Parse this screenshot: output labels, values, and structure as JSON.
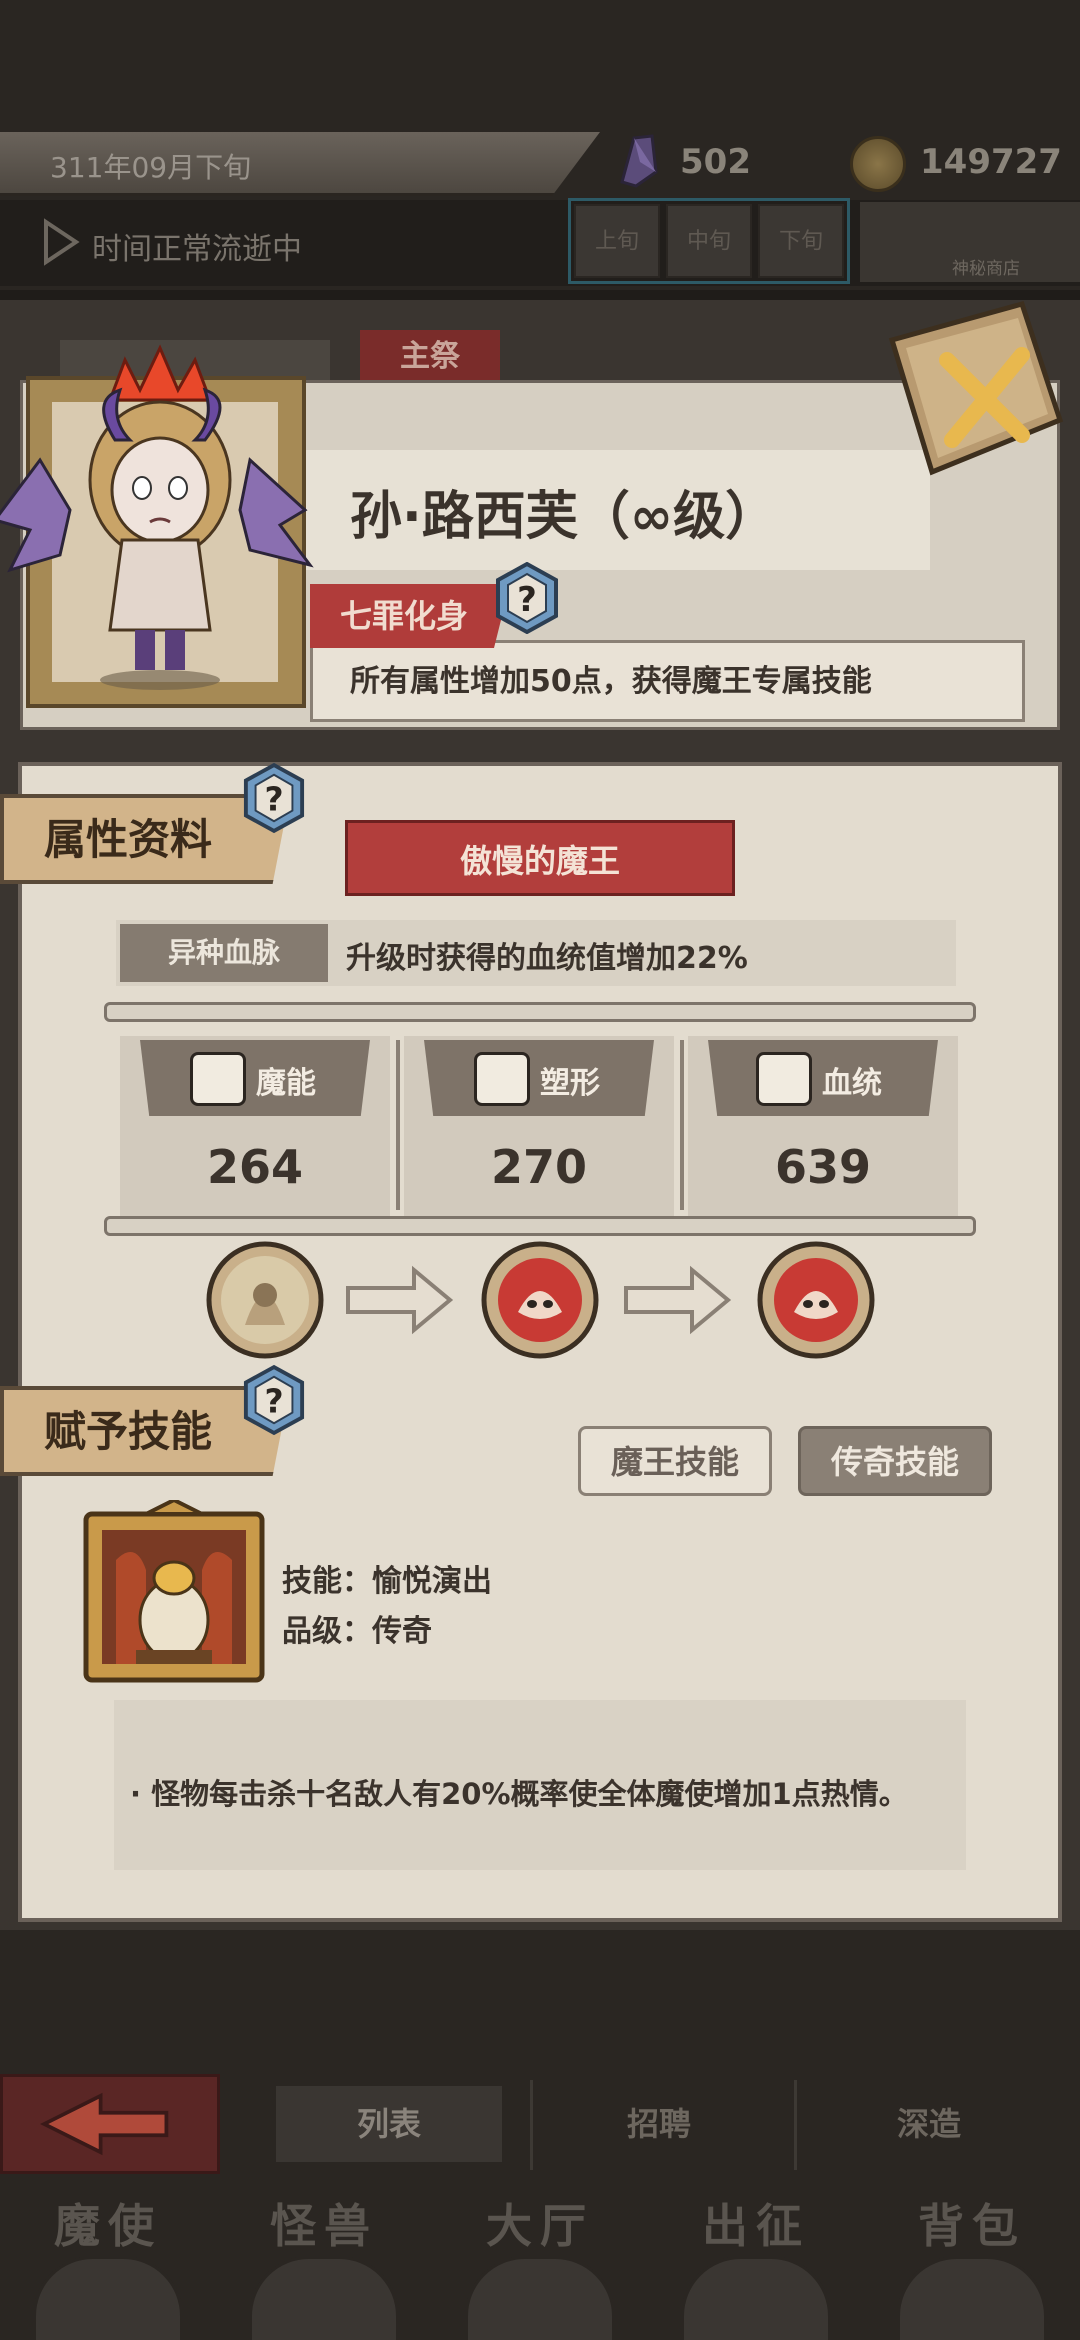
{
  "status": {
    "date": "311年09月下旬",
    "crystals": "502",
    "coins": "149727",
    "time_state": "时间正常流逝中",
    "periods": [
      "上旬",
      "中旬",
      "下旬"
    ],
    "shop_label": "神秘商店"
  },
  "tabs": {
    "main": "主祭"
  },
  "hero": {
    "name": "孙·路西芙（∞级）",
    "title_badge": "七罪化身",
    "title_desc": "所有属性增加50点，获得魔王专属技能"
  },
  "attributes": {
    "section_label": "属性资料",
    "ribbon": "傲慢的魔王",
    "trait_label": "异种血脉",
    "trait_desc": "升级时获得的血统值增加22%",
    "stats": [
      {
        "name": "魔能",
        "value": "264",
        "icon": "magic-energy-icon"
      },
      {
        "name": "塑形",
        "value": "270",
        "icon": "shaping-icon"
      },
      {
        "name": "血统",
        "value": "639",
        "icon": "bloodline-icon"
      }
    ]
  },
  "skills": {
    "section_label": "赋予技能",
    "btn_demon": "魔王技能",
    "btn_legend": "传奇技能",
    "skill_name_line": "技能：愉悦演出",
    "skill_grade_line": "品级：传奇",
    "skill_desc": "·    怪物每击杀十名敌人有20%概率使全体魔使增加1点热情。"
  },
  "nav": {
    "list": "列表",
    "recruit": "招聘",
    "forge": "深造"
  },
  "dock": [
    "魔使",
    "怪兽",
    "大厅",
    "出征",
    "背包"
  ],
  "colors": {
    "accent_red": "#b23e3c",
    "paper": "#e3dccf",
    "dark_bg": "#2a2622"
  }
}
